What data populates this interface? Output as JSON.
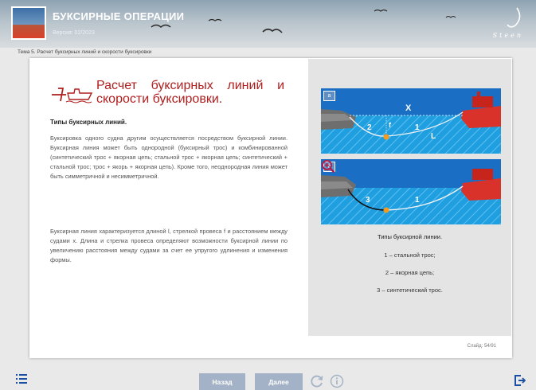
{
  "header": {
    "title": "БУКСИРНЫЕ ОПЕРАЦИИ",
    "version": "Версия: 02/2023",
    "logo_text": "Steen"
  },
  "breadcrumb": "Тема 5. Расчет буксирных линий и скорости буксировки",
  "content": {
    "title_line1_words": [
      "Расчет",
      "буксирных",
      "линий",
      "и"
    ],
    "title_line2": "скорости буксировки.",
    "subtitle": "Типы буксирных линий.",
    "paragraph1": "Буксировка одного судна другим осуществляется посредством буксирной линии. Буксирная линия может быть однородной (буксирный трос) и комбинированной (синтетический трос + якорная цепь; стальной трос + якорная цепь; синтетический + стальной трос; трос + якорь + якорная цепь). Кроме того, неоднородная линия может быть симметричной и несимметричной.",
    "paragraph2": "Буксирная линия характеризуется длиной l, стрелкой провеса f и расстоянием между судами x. Длина и стрелка провеса определяют возможности буксирной линии по увеличению расстояния между судами за счет ее упругого удлинения и изменения формы."
  },
  "illustration_a": {
    "tag": "а",
    "label_x": "X",
    "label_2": "2",
    "label_f": "f",
    "label_1": "1",
    "label_L": "L"
  },
  "illustration_b": {
    "tag": "б",
    "label_3": "3",
    "label_1": "1"
  },
  "caption": {
    "title": "Типы буксирной линии.",
    "item1": "1 – стальной трос;",
    "item2": "2 – якорная цепь;",
    "item3": "3 – синтетический трос."
  },
  "slide_counter": "Слайд: 54/91",
  "nav": {
    "back": "Назад",
    "next": "Далее"
  },
  "colors": {
    "title_red": "#b01d1d",
    "sea_blue": "#1f9ee0",
    "ship_red": "#d8322a",
    "button": "#a3b2c6"
  }
}
